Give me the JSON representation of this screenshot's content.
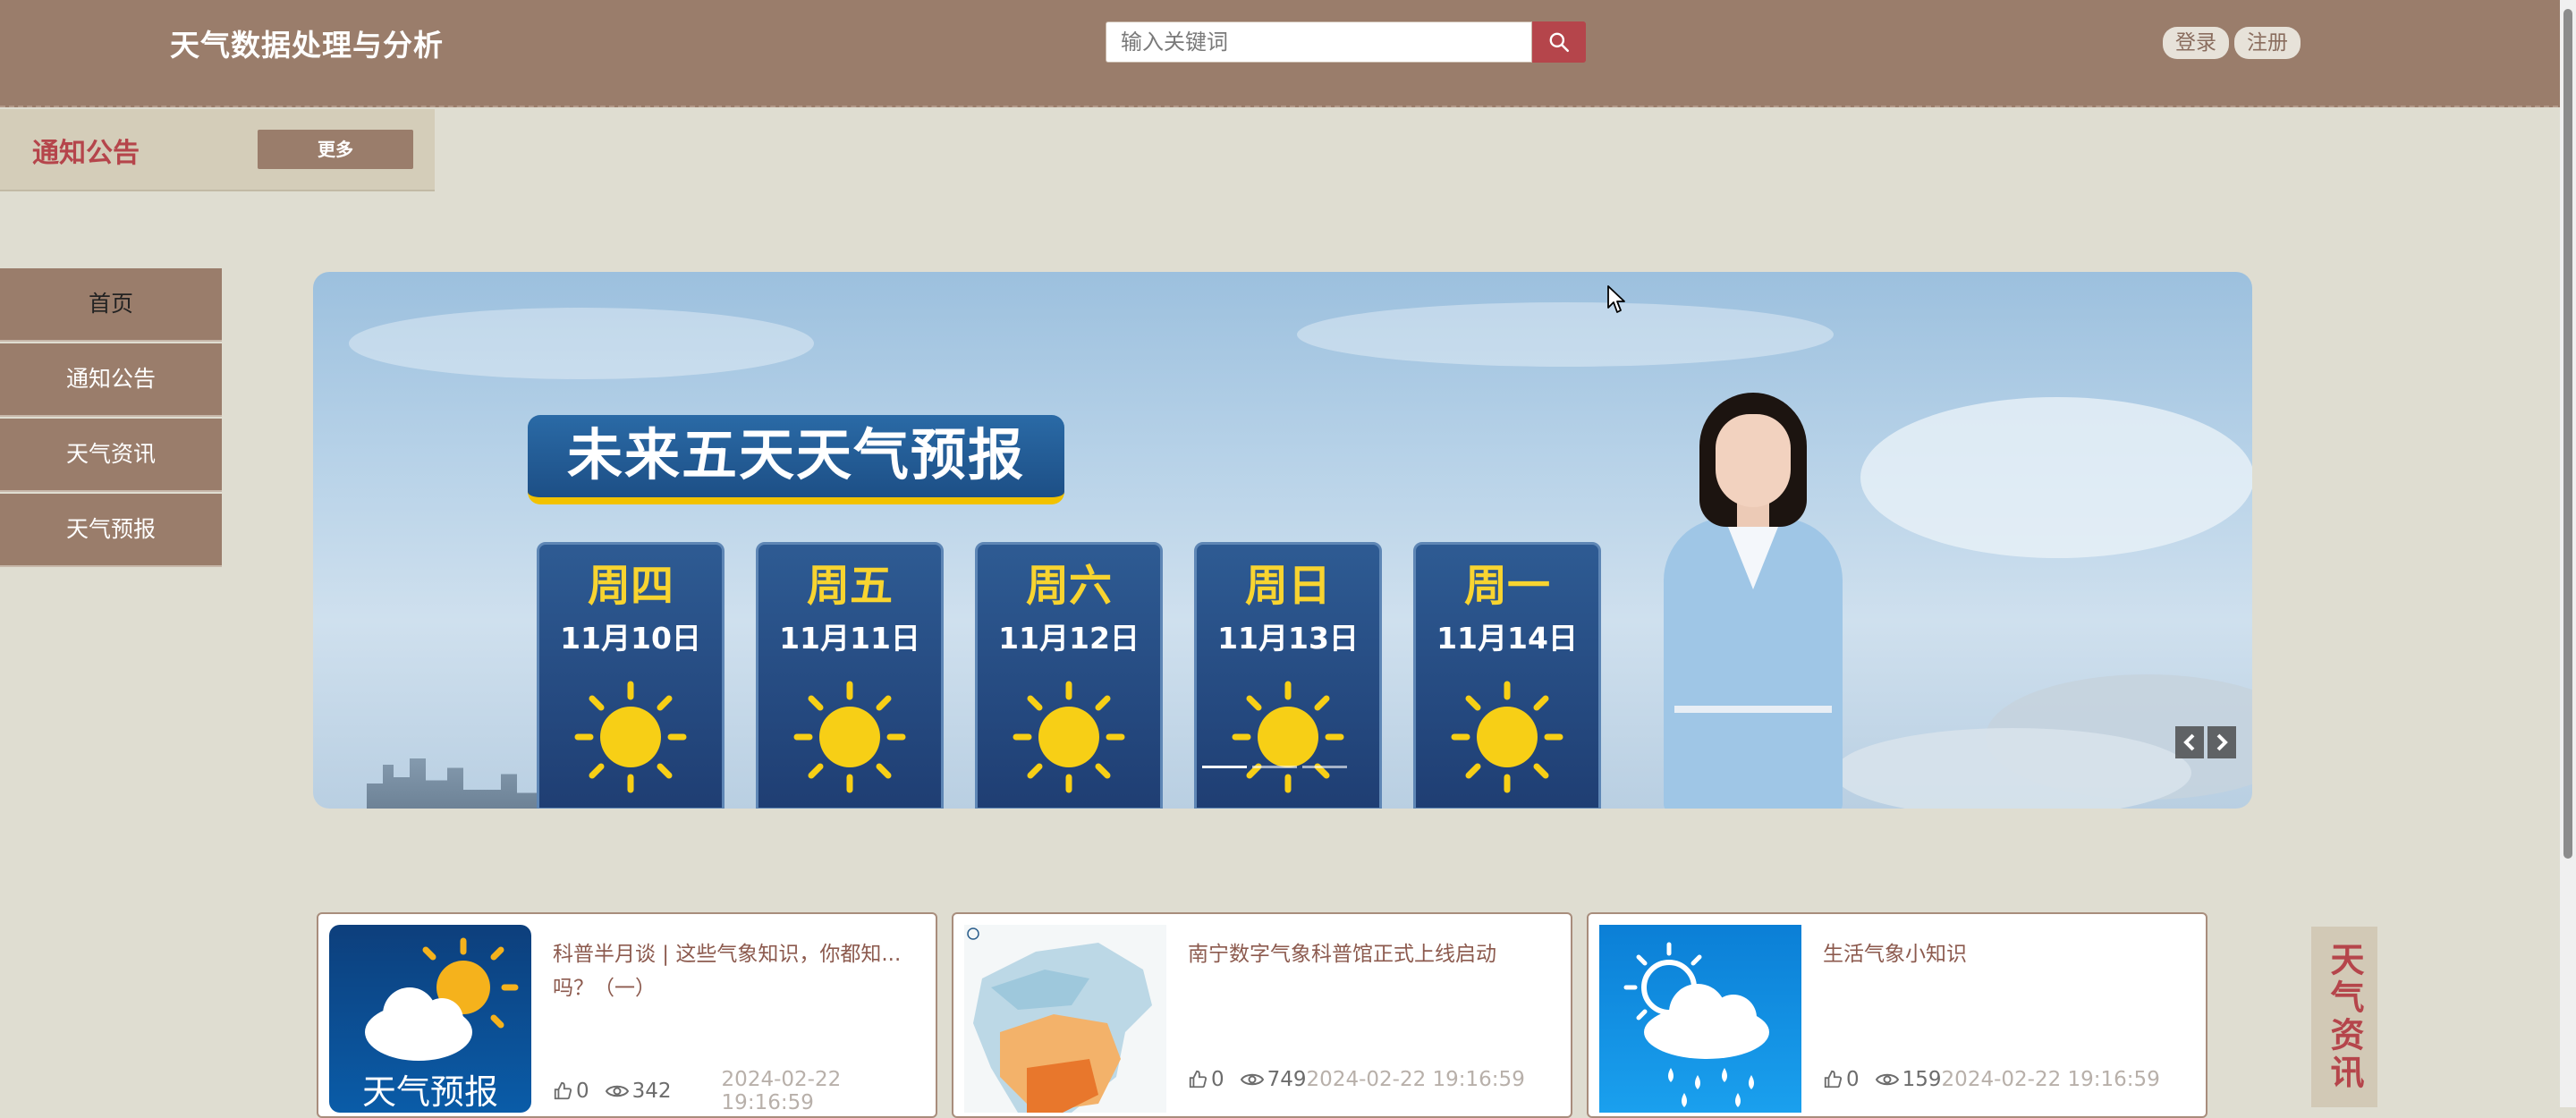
{
  "header": {
    "site_title": "天气数据处理与分析",
    "search_placeholder": "输入关键词",
    "login": "登录",
    "register": "注册"
  },
  "notice": {
    "title": "通知公告",
    "more": "更多"
  },
  "nav": {
    "items": [
      "首页",
      "通知公告",
      "天气资讯",
      "天气预报"
    ],
    "active_index": 0
  },
  "carousel": {
    "banner_title": "未来五天天气预报",
    "days": [
      {
        "name": "周四",
        "date": "11月10日"
      },
      {
        "name": "周五",
        "date": "11月11日"
      },
      {
        "name": "周六",
        "date": "11月12日"
      },
      {
        "name": "周日",
        "date": "11月13日"
      },
      {
        "name": "周一",
        "date": "11月14日"
      }
    ],
    "slide_count": 3,
    "active_slide": 0
  },
  "news": [
    {
      "title": "科普半月谈 | 这些气象知识，你都知...吗？（一）",
      "thumb_text": "天气预报",
      "likes": "0",
      "views": "342",
      "date": "2024-02-22 19:16:59"
    },
    {
      "title": "南宁数字气象科普馆正式上线启动",
      "thumb_text": "",
      "likes": "0",
      "views": "749",
      "date": "2024-02-22 19:16:59"
    },
    {
      "title": "生活气象小知识",
      "thumb_text": "",
      "likes": "0",
      "views": "159",
      "date": "2024-02-22 19:16:59"
    }
  ],
  "side_tab": "天气资讯",
  "colors": {
    "header_bg": "#9a7d6b",
    "page_bg": "#dfddd1",
    "accent_red": "#b5454b"
  }
}
